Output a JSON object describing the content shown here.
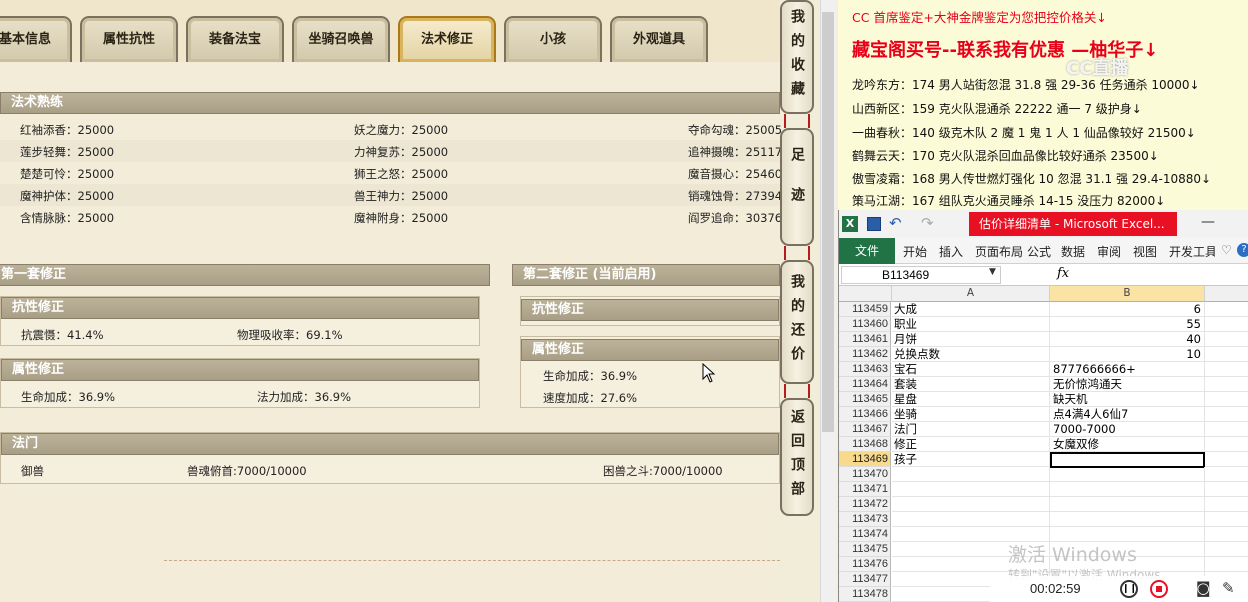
{
  "game": {
    "tabs": [
      "基本信息",
      "属性抗性",
      "装备法宝",
      "坐骑召唤兽",
      "法术修正",
      "小孩",
      "外观道具"
    ],
    "active_tab": "法术修正",
    "skill_section": {
      "title": "法术熟练",
      "rows": [
        [
          "红袖添香：25000",
          "妖之魔力：25000",
          "夺命勾魂：25005"
        ],
        [
          "莲步轻舞：25000",
          "力神复苏：25000",
          "追神摄魄：25117"
        ],
        [
          "楚楚可怜：25000",
          "狮王之怒：25000",
          "魔音摄心：25460"
        ],
        [
          "魔神护体：25000",
          "兽王神力：25000",
          "销魂蚀骨：27394"
        ],
        [
          "含情脉脉：25000",
          "魔神附身：25000",
          "阎罗追命：30376"
        ]
      ]
    },
    "set1": {
      "title": "第一套修正",
      "resist_title": "抗性修正",
      "resist_items": [
        "抗震慑：41.4%",
        "物理吸收率：69.1%"
      ],
      "attr_title": "属性修正",
      "attr_items": [
        "生命加成：36.9%",
        "法力加成：36.9%"
      ]
    },
    "set2": {
      "title": "第二套修正 (当前启用)",
      "resist_title": "抗性修正",
      "attr_title": "属性修正",
      "attr_items": [
        "生命加成：36.9%",
        "速度加成：27.6%"
      ]
    },
    "famen": {
      "title": "法门",
      "items": [
        "御兽",
        "兽魂俯首:7000/10000",
        "困兽之斗:7000/10000"
      ]
    },
    "side_buttons": [
      "我的收藏",
      "足迹",
      "我的还价",
      "返回顶部"
    ]
  },
  "note": {
    "header": "CC 首席鉴定+大神金牌鉴定为您把控价格关↓",
    "banner": "藏宝阁买号--联系我有优惠 —柚华子↓",
    "lines": [
      "龙吟东方：174 男人站街忽混 31.8 强 29-36 任务通杀 10000↓",
      "山西新区：159 克火队混通杀 22222 通一 7 级护身↓",
      "一曲春秋：140 级克木队 2 魔 1 鬼 1 人 1 仙品像较好 21500↓",
      "鹤舞云天：170 克火队混杀回血品像比较好通杀 23500↓",
      "傲雪凌霜：168 男人传世燃灯强化 10 忽混 31.1 强 29.4-10880↓",
      "策马江湖：167 组队克火通灵睡杀 14-15 没压力 82000↓"
    ],
    "watermark": "CC直播"
  },
  "excel": {
    "title": "估价详细清单 - Microsoft Excel...",
    "ribbon_tabs": [
      "文件",
      "开始",
      "插入",
      "页面布局",
      "公式",
      "数据",
      "审阅",
      "视图",
      "开发工具"
    ],
    "name_box": "B113469",
    "fx": "fx",
    "columns": [
      "A",
      "B"
    ],
    "rows": [
      {
        "num": "113459",
        "a": "大成",
        "b": "6",
        "numeric": true
      },
      {
        "num": "113460",
        "a": "职业",
        "b": "55",
        "numeric": true
      },
      {
        "num": "113461",
        "a": "月饼",
        "b": "40",
        "numeric": true
      },
      {
        "num": "113462",
        "a": "兑换点数",
        "b": "10",
        "numeric": true
      },
      {
        "num": "113463",
        "a": "宝石",
        "b": "8777666666+",
        "numeric": false
      },
      {
        "num": "113464",
        "a": "套装",
        "b": "无价惊鸿通天",
        "numeric": false
      },
      {
        "num": "113465",
        "a": "星盘",
        "b": "缺天机",
        "numeric": false
      },
      {
        "num": "113466",
        "a": "坐骑",
        "b": "点4满4人6仙7",
        "numeric": false
      },
      {
        "num": "113467",
        "a": "法门",
        "b": "7000-7000",
        "numeric": false
      },
      {
        "num": "113468",
        "a": "修正",
        "b": "女魔双修",
        "numeric": false
      },
      {
        "num": "113469",
        "a": "孩子",
        "b": "",
        "numeric": false,
        "selected": true
      },
      {
        "num": "113470",
        "a": "",
        "b": "",
        "numeric": false
      },
      {
        "num": "113471",
        "a": "",
        "b": "",
        "numeric": false
      },
      {
        "num": "113472",
        "a": "",
        "b": "",
        "numeric": false
      },
      {
        "num": "113473",
        "a": "",
        "b": "",
        "numeric": false
      },
      {
        "num": "113474",
        "a": "",
        "b": "",
        "numeric": false
      },
      {
        "num": "113475",
        "a": "",
        "b": "",
        "numeric": false
      },
      {
        "num": "113476",
        "a": "",
        "b": "",
        "numeric": false
      },
      {
        "num": "113477",
        "a": "",
        "b": "",
        "numeric": false
      },
      {
        "num": "113478",
        "a": "",
        "b": "",
        "numeric": false
      }
    ]
  },
  "windows_watermark": {
    "line1": "激活 Windows",
    "line2": "转到\"设置\"以激活 Windows。"
  },
  "recorder": {
    "time": "00:02:59"
  },
  "colors": {
    "note_header": "#e8001a",
    "excel_file_tab": "#217346",
    "excel_title_bg": "#e81123",
    "selected_row": "#f8da8c"
  }
}
